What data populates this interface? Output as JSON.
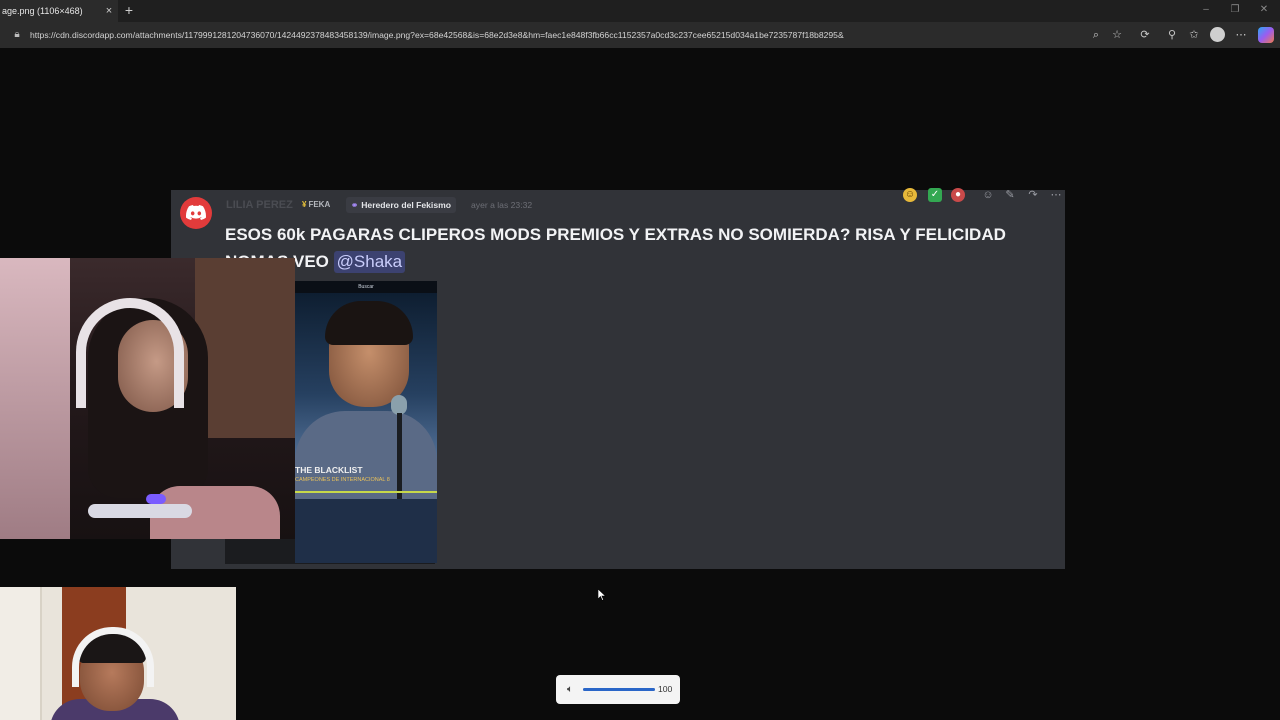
{
  "browser": {
    "tab_title": "age.png (1106×468)",
    "tab_close": "×",
    "new_tab": "+",
    "url": "https://cdn.discordapp.com/attachments/1179991281204736070/1424492378483458139/image.png?ex=68e42568&is=68e2d3e8&hm=faec1e848f3fb66cc1152357a0cd3c237cee65215d034a1be7235787f18b8295&",
    "icons": [
      "lock-icon",
      "zoom-icon",
      "star-icon",
      "extensions-icon",
      "pin-icon",
      "favorites-icon",
      "profile-icon",
      "more-icon",
      "copilot-icon"
    ],
    "window_controls": [
      "minimize",
      "restore",
      "close"
    ]
  },
  "message": {
    "username": "LILIA PEREZ",
    "tag_primary": "FEKA",
    "tag_secondary": "Heredero del Fekismo",
    "timestamp": "ayer a las 23:32",
    "text": "ESOS 60k PAGARAS CLIPEROS MODS PREMIOS Y EXTRAS NO SOMIERDA? RISA Y FELICIDAD NOMAS VEO",
    "mention": "@Shaka",
    "attachment": {
      "top_label": "Buscar",
      "banner_title": "THE BLACKLIST",
      "banner_subtitle": "CAMPEONES DE INTERNACIONAL 8"
    }
  },
  "volume": {
    "value": "100",
    "level": 1.0
  },
  "colors": {
    "card_bg": "#313338",
    "mention_bg": "#3c4270",
    "discord_red": "#e23b3b",
    "volume_accent": "#2a66c8"
  }
}
